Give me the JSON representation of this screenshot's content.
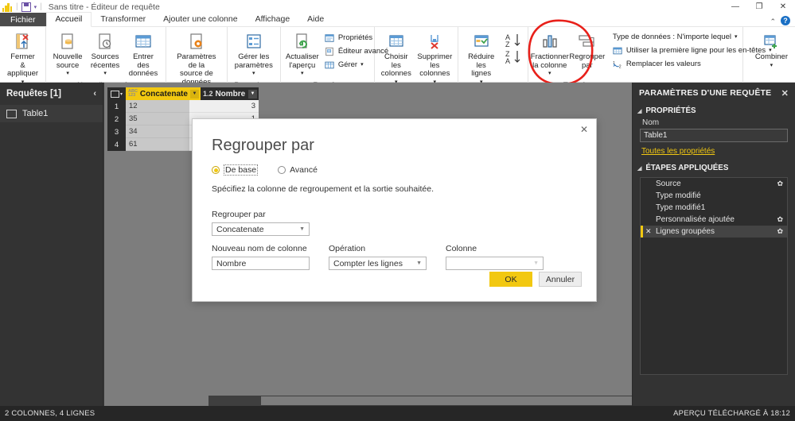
{
  "window": {
    "title": "Sans titre - Éditeur de requête",
    "logo": "power-bi-logo",
    "save_icon": "save-icon",
    "qat_caret": "▾",
    "minimize": "—",
    "restore": "❐",
    "close": "✕",
    "help": "?",
    "collapse_ribbon": "⌃"
  },
  "tabs": [
    {
      "label": "Fichier",
      "kind": "file"
    },
    {
      "label": "Accueil",
      "kind": "active"
    },
    {
      "label": "Transformer",
      "kind": "normal"
    },
    {
      "label": "Ajouter une colonne",
      "kind": "normal"
    },
    {
      "label": "Affichage",
      "kind": "normal"
    },
    {
      "label": "Aide",
      "kind": "normal"
    }
  ],
  "ribbon": {
    "groups": [
      {
        "title": "Fermer",
        "buttons": [
          {
            "label": "Fermer &\nappliquer",
            "icon": "close-and-apply-icon",
            "caret": "▾"
          }
        ]
      },
      {
        "title": "Nouvelle requête",
        "buttons": [
          {
            "label": "Nouvelle\nsource",
            "icon": "new-source-icon",
            "caret": "▾"
          },
          {
            "label": "Sources\nrécentes",
            "icon": "recent-sources-icon",
            "caret": "▾"
          },
          {
            "label": "Entrer des\ndonnées",
            "icon": "enter-data-icon",
            "caret": ""
          }
        ]
      },
      {
        "title": "Sources de données",
        "buttons": [
          {
            "label": "Paramètres de la\nsource de données",
            "icon": "data-source-settings-icon",
            "caret": ""
          }
        ]
      },
      {
        "title": "Paramètres",
        "buttons": [
          {
            "label": "Gérer les\nparamètres",
            "icon": "manage-parameters-icon",
            "caret": "▾"
          }
        ]
      },
      {
        "title": "Requête",
        "buttons": [
          {
            "label": "Actualiser\nl'aperçu",
            "icon": "refresh-preview-icon",
            "caret": "▾"
          }
        ],
        "small": [
          {
            "label": "Propriétés",
            "icon": "properties-icon",
            "caret": ""
          },
          {
            "label": "Éditeur avancé",
            "icon": "advanced-editor-icon",
            "caret": ""
          },
          {
            "label": "Gérer",
            "icon": "manage-icon",
            "caret": "▾"
          }
        ]
      },
      {
        "title": "Gérer les colonnes",
        "buttons": [
          {
            "label": "Choisir les\ncolonnes",
            "icon": "choose-columns-icon",
            "caret": "▾"
          },
          {
            "label": "Supprimer les\ncolonnes",
            "icon": "remove-columns-icon",
            "caret": "▾"
          }
        ]
      },
      {
        "title": "",
        "buttons": [
          {
            "label": "Réduire les\nlignes",
            "icon": "reduce-rows-icon",
            "caret": "▾"
          }
        ]
      },
      {
        "title": "Trier",
        "buttons": [
          {
            "label": "",
            "icon": "sort-ascending-descending-icon",
            "caret": ""
          }
        ]
      },
      {
        "title": "Transformer",
        "buttons": [
          {
            "label": "Fractionner\nla colonne",
            "icon": "split-column-icon",
            "caret": "▾"
          },
          {
            "label": "Regrouper\npar",
            "icon": "group-by-icon",
            "caret": ""
          }
        ],
        "small": [
          {
            "label": "Type de données : N'importe lequel",
            "icon": "data-type-icon",
            "caret": "▾"
          },
          {
            "label": "Utiliser la première ligne pour les en-têtes",
            "icon": "use-first-row-headers-icon",
            "caret": "▾"
          },
          {
            "label": "Remplacer les valeurs",
            "icon": "replace-values-icon",
            "caret": ""
          }
        ]
      },
      {
        "title": "",
        "buttons": [
          {
            "label": "Combiner",
            "icon": "combine-icon",
            "caret": "▾"
          }
        ]
      }
    ]
  },
  "queries_pane": {
    "header": "Requêtes [1]",
    "collapse_icon": "chevron-left-icon",
    "items": [
      {
        "label": "Table1",
        "icon": "table-icon"
      }
    ]
  },
  "grid": {
    "corner_icon": "select-all-icon",
    "columns": [
      {
        "name": "Concatenate",
        "type_badge": "ABC\n123",
        "selected": true
      },
      {
        "name": "Nombre",
        "type_badge": "1.2",
        "selected": false
      }
    ],
    "rows": [
      {
        "num": "1",
        "concatenate": "12",
        "nombre": "3"
      },
      {
        "num": "2",
        "concatenate": "35",
        "nombre": "1"
      },
      {
        "num": "3",
        "concatenate": "34",
        "nombre": ""
      },
      {
        "num": "4",
        "concatenate": "61",
        "nombre": ""
      }
    ]
  },
  "settings_pane": {
    "title": "PARAMÈTRES D'UNE REQUÊTE",
    "close_icon": "close-icon",
    "properties_section": "PROPRIÉTÉS",
    "name_label": "Nom",
    "name_value": "Table1",
    "all_properties_link": "Toutes les propriétés",
    "steps_section": "ÉTAPES APPLIQUÉES",
    "steps": [
      {
        "label": "Source",
        "gear": true,
        "selected": false,
        "deletable": false
      },
      {
        "label": "Type modifié",
        "gear": false,
        "selected": false,
        "deletable": false
      },
      {
        "label": "Type modifié1",
        "gear": false,
        "selected": false,
        "deletable": false
      },
      {
        "label": "Personnalisée ajoutée",
        "gear": true,
        "selected": false,
        "deletable": false
      },
      {
        "label": "Lignes groupées",
        "gear": true,
        "selected": true,
        "deletable": true
      }
    ]
  },
  "dialog": {
    "title": "Regrouper par",
    "close_icon": "close-icon",
    "mode_basic": "De base",
    "mode_advanced": "Avancé",
    "description": "Spécifiez la colonne de regroupement et la sortie souhaitée.",
    "group_by_label": "Regrouper par",
    "group_by_value": "Concatenate",
    "new_column_label": "Nouveau nom de colonne",
    "new_column_value": "Nombre",
    "operation_label": "Opération",
    "operation_value": "Compter les lignes",
    "column_label": "Colonne",
    "column_value": "",
    "ok": "OK",
    "cancel": "Annuler"
  },
  "status_bar": {
    "left": "2 COLONNES, 4 LIGNES",
    "right": "APERÇU TÉLÉCHARGÉ À 18:12"
  },
  "colors": {
    "accent_yellow": "#F2C811",
    "annotation_red": "#E8201A",
    "dark_panel": "#333333"
  }
}
